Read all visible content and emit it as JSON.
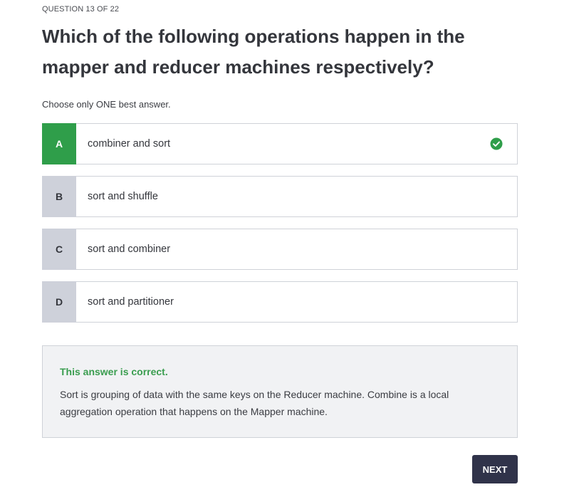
{
  "quiz": {
    "counter": "QUESTION 13 OF 22",
    "question": "Which of the following operations happen in the mapper and reducer machines respectively?",
    "instruction": "Choose only ONE best answer.",
    "options": [
      {
        "letter": "A",
        "text": "combiner and sort",
        "state": "correct"
      },
      {
        "letter": "B",
        "text": "sort and shuffle",
        "state": "unselected"
      },
      {
        "letter": "C",
        "text": "sort and combiner",
        "state": "unselected"
      },
      {
        "letter": "D",
        "text": "sort and partitioner",
        "state": "unselected"
      }
    ],
    "correct_icon": "check-circle-icon"
  },
  "feedback": {
    "status": "This answer is correct.",
    "explanation": "Sort is grouping of data with the same keys on the Reducer machine. Combine is a local aggregation operation that happens on the Mapper machine."
  },
  "actions": {
    "next_label": "NEXT"
  },
  "colors": {
    "correct": "#2f9e4a",
    "letter_bg": "#ced1da",
    "next_bg": "#30334a",
    "feedback_bg": "#f1f2f4"
  }
}
